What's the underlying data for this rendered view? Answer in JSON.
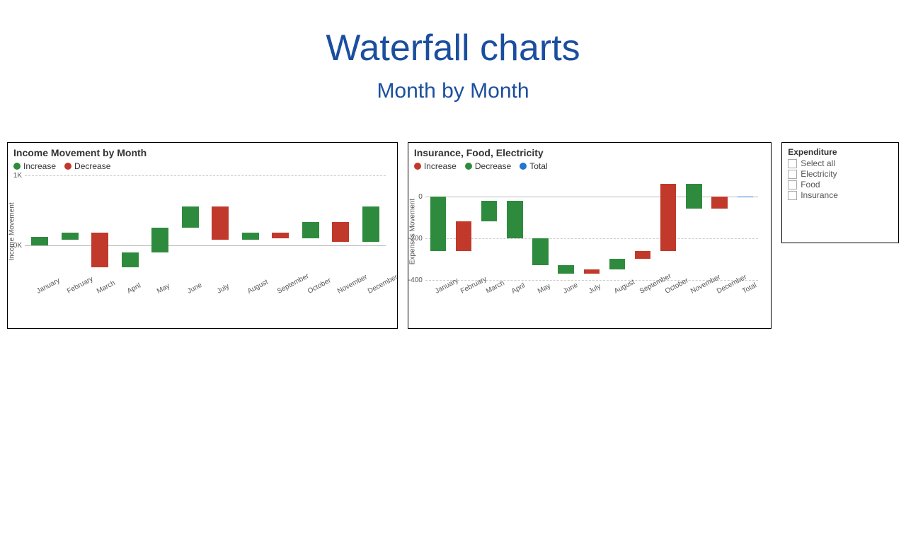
{
  "page": {
    "title": "Waterfall charts",
    "subtitle": "Month by Month"
  },
  "chart_data": [
    {
      "id": "income",
      "type": "waterfall",
      "title": "Income Movement by Month",
      "ylabel": "Income Movement",
      "ylim": [
        -500,
        1000
      ],
      "yticks": [
        {
          "v": 0,
          "label": "0K"
        },
        {
          "v": 1000,
          "label": "1K"
        }
      ],
      "legend": [
        {
          "label": "Increase",
          "color": "#2e8b3d"
        },
        {
          "label": "Decrease",
          "color": "#c0392b"
        }
      ],
      "categories": [
        "January",
        "February",
        "March",
        "April",
        "May",
        "June",
        "July",
        "August",
        "September",
        "October",
        "November",
        "December"
      ],
      "bars": [
        {
          "kind": "inc",
          "from": 0,
          "to": 120
        },
        {
          "kind": "inc",
          "from": 80,
          "to": 180
        },
        {
          "kind": "dec",
          "from": 180,
          "to": -320
        },
        {
          "kind": "inc",
          "from": -320,
          "to": -100
        },
        {
          "kind": "inc",
          "from": -100,
          "to": 250
        },
        {
          "kind": "inc",
          "from": 250,
          "to": 550
        },
        {
          "kind": "dec",
          "from": 550,
          "to": 80
        },
        {
          "kind": "inc",
          "from": 80,
          "to": 180
        },
        {
          "kind": "dec",
          "from": 180,
          "to": 100
        },
        {
          "kind": "inc",
          "from": 100,
          "to": 330
        },
        {
          "kind": "dec",
          "from": 330,
          "to": 50
        },
        {
          "kind": "inc",
          "from": 50,
          "to": 550
        }
      ]
    },
    {
      "id": "expenses",
      "type": "waterfall",
      "title": "Insurance, Food, Electricity",
      "ylabel": "Expenses Movement",
      "ylim": [
        -400,
        100
      ],
      "yticks": [
        {
          "v": 0,
          "label": "0"
        },
        {
          "v": -200,
          "label": "-200"
        },
        {
          "v": -400,
          "label": "-400"
        }
      ],
      "legend": [
        {
          "label": "Increase",
          "color": "#c0392b"
        },
        {
          "label": "Decrease",
          "color": "#2e8b3d"
        },
        {
          "label": "Total",
          "color": "#1f77d0"
        }
      ],
      "categories": [
        "January",
        "February",
        "March",
        "April",
        "May",
        "June",
        "July",
        "August",
        "September",
        "October",
        "November",
        "December",
        "Total"
      ],
      "bars": [
        {
          "kind": "dec",
          "from": 0,
          "to": -260
        },
        {
          "kind": "inc",
          "from": -260,
          "to": -120
        },
        {
          "kind": "dec",
          "from": -120,
          "to": -20
        },
        {
          "kind": "dec",
          "from": -20,
          "to": -200
        },
        {
          "kind": "dec",
          "from": -200,
          "to": -330
        },
        {
          "kind": "dec",
          "from": -330,
          "to": -370
        },
        {
          "kind": "inc",
          "from": -370,
          "to": -350
        },
        {
          "kind": "dec",
          "from": -350,
          "to": -300
        },
        {
          "kind": "inc",
          "from": -300,
          "to": -260
        },
        {
          "kind": "inc",
          "from": -260,
          "to": 60
        },
        {
          "kind": "dec",
          "from": 60,
          "to": -60
        },
        {
          "kind": "inc",
          "from": -60,
          "to": 0
        },
        {
          "kind": "total",
          "from": 0,
          "to": 0
        }
      ]
    }
  ],
  "filter": {
    "title": "Expenditure",
    "items": [
      "Select all",
      "Electricity",
      "Food",
      "Insurance"
    ]
  }
}
